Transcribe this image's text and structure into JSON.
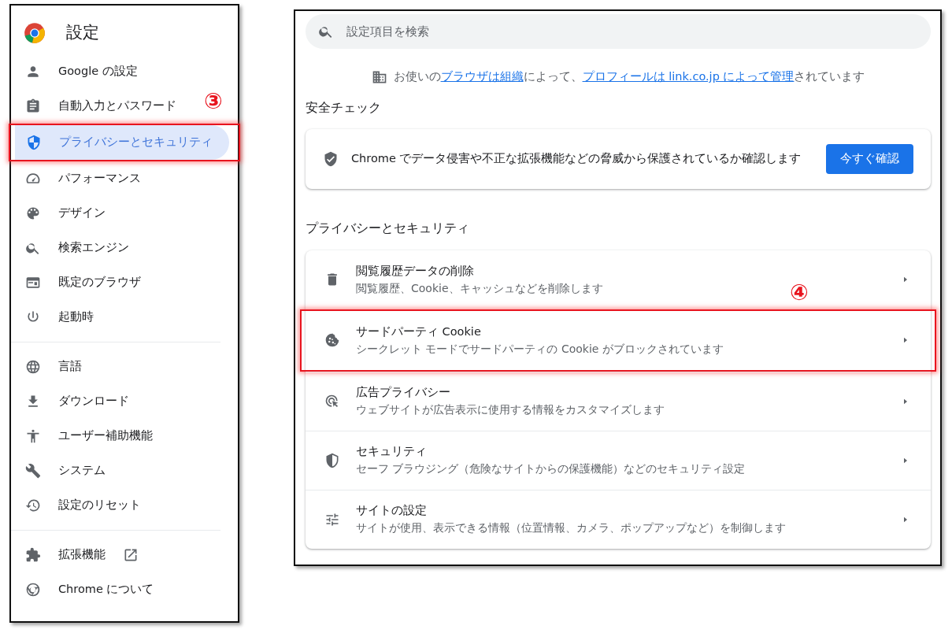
{
  "sidebar": {
    "title": "設定",
    "callout": "③",
    "groups": [
      [
        {
          "label": "Google の設定",
          "selected": false,
          "highlighted": false
        },
        {
          "label": "自動入力とパスワード",
          "selected": false,
          "highlighted": false
        },
        {
          "label": "プライバシーとセキュリティ",
          "selected": true,
          "highlighted": true
        },
        {
          "label": "パフォーマンス",
          "selected": false,
          "highlighted": false
        },
        {
          "label": "デザイン",
          "selected": false,
          "highlighted": false
        },
        {
          "label": "検索エンジン",
          "selected": false,
          "highlighted": false
        },
        {
          "label": "既定のブラウザ",
          "selected": false,
          "highlighted": false
        },
        {
          "label": "起動時",
          "selected": false,
          "highlighted": false
        }
      ],
      [
        {
          "label": "言語",
          "selected": false,
          "highlighted": false
        },
        {
          "label": "ダウンロード",
          "selected": false,
          "highlighted": false
        },
        {
          "label": "ユーザー補助機能",
          "selected": false,
          "highlighted": false
        },
        {
          "label": "システム",
          "selected": false,
          "highlighted": false
        },
        {
          "label": "設定のリセット",
          "selected": false,
          "highlighted": false
        }
      ],
      [
        {
          "label": "拡張機能",
          "selected": false,
          "highlighted": false
        },
        {
          "label": "Chrome について",
          "selected": false,
          "highlighted": false
        }
      ]
    ]
  },
  "main": {
    "search": {
      "placeholder": "設定項目を検索"
    },
    "notice": [
      {
        "kind": "text",
        "text": "お使いの"
      },
      {
        "kind": "link",
        "text": "ブラウザは組織"
      },
      {
        "kind": "text",
        "text": "によって、"
      },
      {
        "kind": "link",
        "text": "プロフィールは link.co.jp によって管理"
      },
      {
        "kind": "text",
        "text": "されています"
      }
    ],
    "safety_check": {
      "heading": "安全チェック",
      "text": "Chrome でデータ侵害や不正な拡張機能などの脅威から保護されているか確認します",
      "button": "今すぐ確認"
    },
    "privacy": {
      "heading": "プライバシーとセキュリティ",
      "callout": "④",
      "rows": [
        {
          "title": "閲覧履歴データの削除",
          "subtitle": "閲覧履歴、Cookie、キャッシュなどを削除します",
          "highlighted": false
        },
        {
          "title": "サードパーティ Cookie",
          "subtitle": "シークレット モードでサードパーティの Cookie がブロックされています",
          "highlighted": true
        },
        {
          "title": "広告プライバシー",
          "subtitle": "ウェブサイトが広告表示に使用する情報をカスタマイズします",
          "highlighted": false
        },
        {
          "title": "セキュリティ",
          "subtitle": "セーフ ブラウジング（危険なサイトからの保護機能）などのセキュリティ設定",
          "highlighted": false
        },
        {
          "title": "サイトの設定",
          "subtitle": "サイトが使用、表示できる情報（位置情報、カメラ、ポップアップなど）を制御します",
          "highlighted": false
        }
      ]
    }
  }
}
